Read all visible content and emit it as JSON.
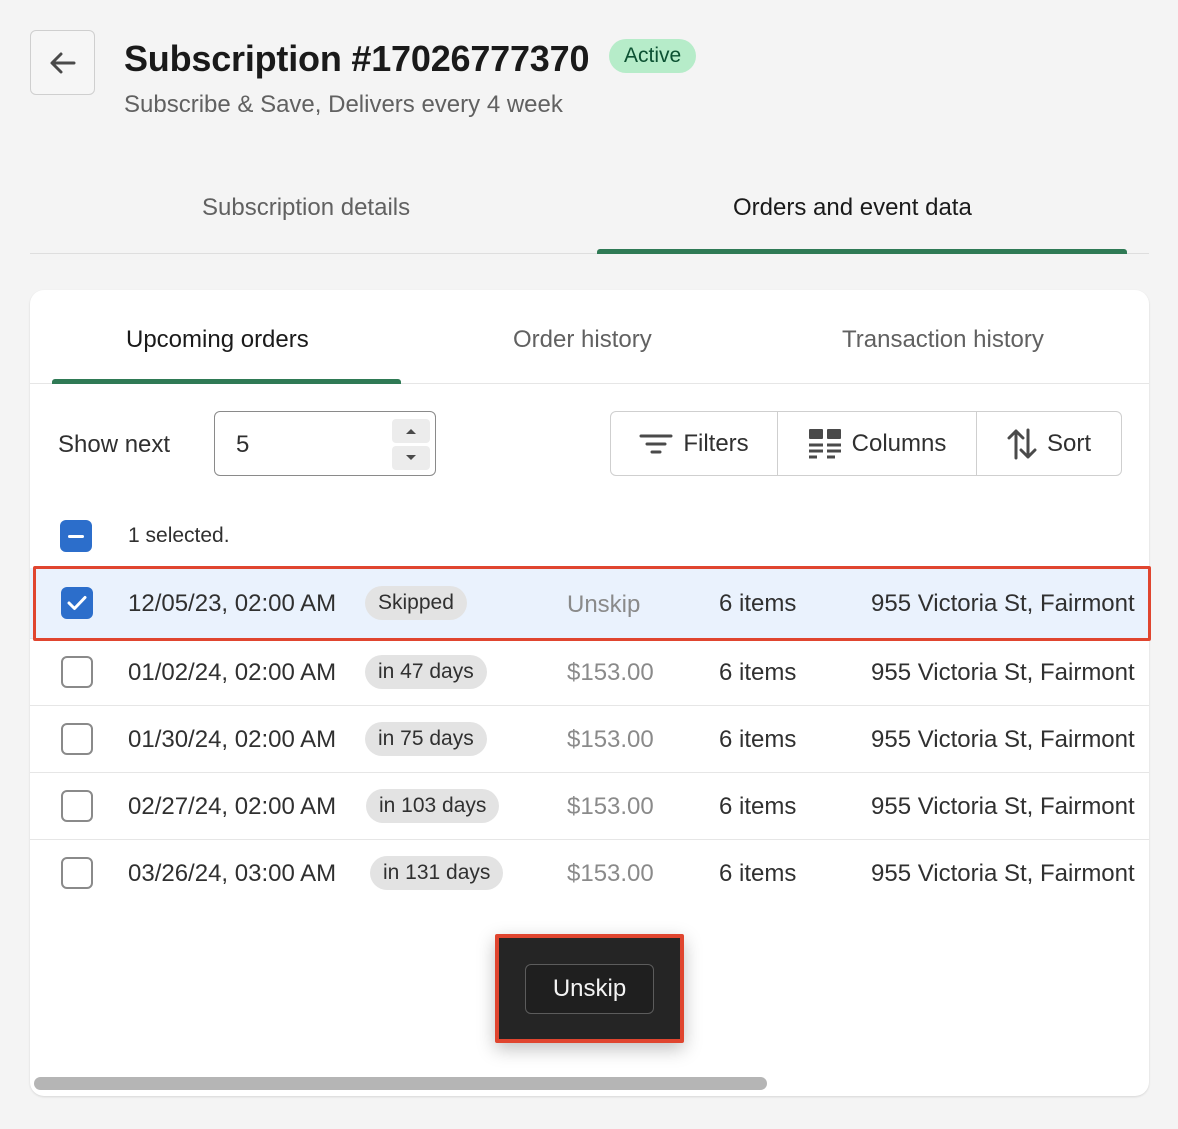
{
  "header": {
    "title": "Subscription #17026777370",
    "status": "Active",
    "subtitle": "Subscribe & Save, Delivers every 4 week"
  },
  "main_tabs": [
    {
      "label": "Subscription details",
      "active": false
    },
    {
      "label": "Orders and event data",
      "active": true
    }
  ],
  "sub_tabs": [
    {
      "label": "Upcoming orders",
      "active": true
    },
    {
      "label": "Order history",
      "active": false
    },
    {
      "label": "Transaction history",
      "active": false
    }
  ],
  "show_next": {
    "label": "Show next",
    "value": "5"
  },
  "toolbar": {
    "filters": "Filters",
    "columns": "Columns",
    "sort": "Sort"
  },
  "selection": {
    "text": "1 selected."
  },
  "rows": [
    {
      "date": "12/05/23, 02:00 AM",
      "badge": "Skipped",
      "price": "Unskip",
      "items": "6 items",
      "address": "955 Victoria St, Fairmont",
      "checked": true
    },
    {
      "date": "01/02/24, 02:00 AM",
      "badge": "in 47 days",
      "price": "$153.00",
      "items": "6 items",
      "address": "955 Victoria St, Fairmont",
      "checked": false
    },
    {
      "date": "01/30/24, 02:00 AM",
      "badge": "in 75 days",
      "price": "$153.00",
      "items": "6 items",
      "address": "955 Victoria St, Fairmont",
      "checked": false
    },
    {
      "date": "02/27/24, 02:00 AM",
      "badge": "in 103 days",
      "price": "$153.00",
      "items": "6 items",
      "address": "955 Victoria St, Fairmont",
      "checked": false
    },
    {
      "date": "03/26/24, 03:00 AM",
      "badge": "in 131 days",
      "price": "$153.00",
      "items": "6 items",
      "address": "955 Victoria St, Fairmont",
      "checked": false
    }
  ],
  "bulk_action": {
    "label": "Unskip"
  },
  "colors": {
    "accent": "#2f7a55",
    "checkbox": "#2c6ecb",
    "highlight": "#e0452f",
    "active_badge_bg": "#b6ecc9"
  }
}
